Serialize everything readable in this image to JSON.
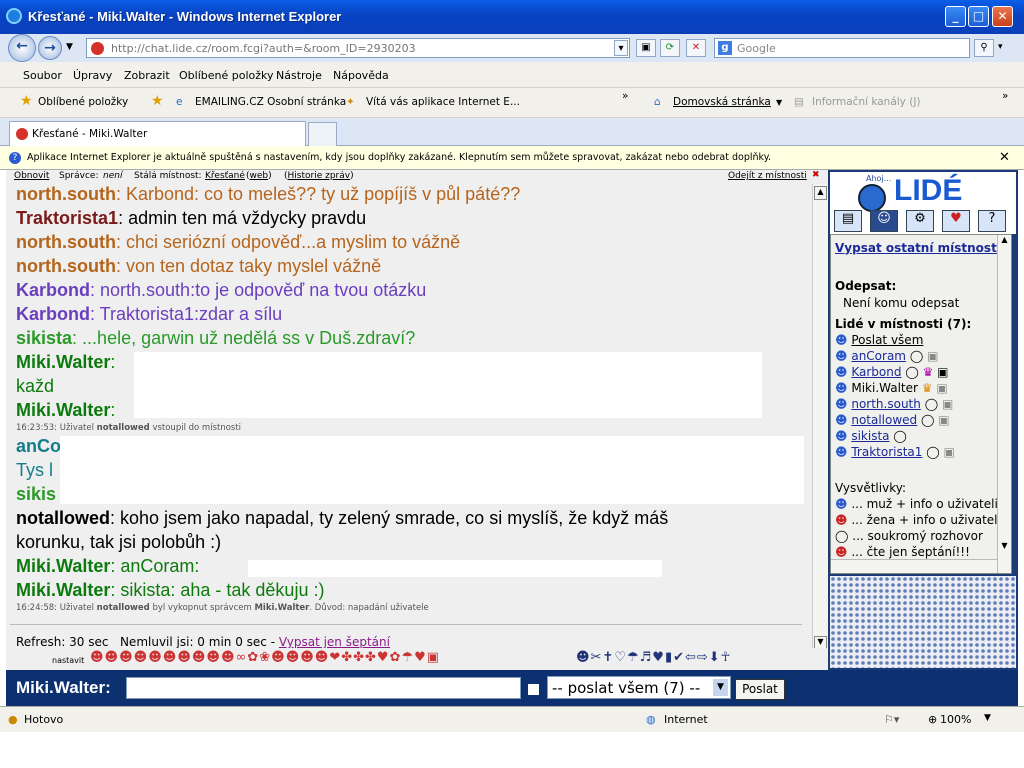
{
  "window": {
    "title": "Křesťané - Miki.Walter - Windows Internet Explorer"
  },
  "address": {
    "url": "http://chat.lide.cz/room.fcgi?auth=&room_ID=2930203",
    "search_placeholder": "Google"
  },
  "menu": [
    "Soubor",
    "Úpravy",
    "Zobrazit",
    "Oblíbené položky",
    "Nástroje",
    "Nápověda"
  ],
  "favbar": {
    "favorites": "Oblíbené položky",
    "link1": "EMAILING.CZ  Osobní stránka",
    "link2": "Vítá vás aplikace Internet E...",
    "home": "Domovská stránka",
    "feeds": "Informační kanály (J)"
  },
  "tab": {
    "label": "Křesťané - Miki.Walter"
  },
  "infobar": {
    "text": "Aplikace Internet Explorer je aktuálně spuštěná s nastavením, kdy jsou doplňky zakázané. Klepnutím sem můžete spravovat, zakázat nebo odebrat doplňky."
  },
  "chat_header": {
    "refresh_link": "Obnovit",
    "admin_label": "Správce:",
    "admin_value": "není",
    "room_label": "Stálá místnost:",
    "room_name": "Křesťané",
    "web_link": "web",
    "history_link": "Historie zpráv",
    "leave_link": "Odejít z místnosti"
  },
  "messages": [
    {
      "user": "north.south",
      "text": ": Karbond: co to meleš?? ty už popíjíš v půl páté??",
      "color": "#b5651d"
    },
    {
      "user": "Traktorista1",
      "text": ": admin ten má vždycky pravdu",
      "color": "#7a1a1a"
    },
    {
      "user": "north.south",
      "text": ": chci seriózní odpověď...a myslim to vážně",
      "color": "#b5651d"
    },
    {
      "user": "north.south",
      "text": ": von ten dotaz taky myslel vážně",
      "color": "#b5651d"
    },
    {
      "user": "Karbond",
      "text": ": north.south:to je odpověď na tvou otázku",
      "color": "#6a3fbf"
    },
    {
      "user": "Karbond",
      "text": ": Traktorista1:zdar a sílu",
      "color": "#6a3fbf"
    },
    {
      "user": "sikista",
      "text": ": ...hele, garwin už nedělá ss v Duš.zdraví?",
      "color": "#2a9a2a"
    },
    {
      "user": "Miki.Walter",
      "text": ":",
      "color": "#0d7a0d"
    },
    {
      "user": "",
      "text": "každ",
      "color": "#0d7a0d"
    },
    {
      "user": "Miki.Walter",
      "text": ":",
      "color": "#0d7a0d"
    },
    {
      "user": "anCo",
      "text": "",
      "color": "#137e8a"
    },
    {
      "user": "",
      "text": "Tys l",
      "color": "#137e8a"
    },
    {
      "user": "sikis",
      "text": "",
      "color": "#2a9a2a"
    },
    {
      "user": "notallowed",
      "text": ": koho jsem jako napadal, ty zelený smrade, co si myslíš, že když máš",
      "color": "#000000"
    },
    {
      "user": "",
      "text": "korunku, tak jsi polobůh :)",
      "color": "#000000"
    },
    {
      "user": "Miki.Walter",
      "text": ": anCoram:",
      "color": "#0d7a0d"
    },
    {
      "user": "Miki.Walter",
      "text": ": sikista: aha - tak děkuju :)",
      "color": "#0d7a0d"
    }
  ],
  "system": {
    "join": {
      "time": "16:23:53:",
      "pre": "Uživatel",
      "user": "notallowed",
      "post": "vstoupil do místnosti"
    },
    "kick": {
      "time": "16:24:58:",
      "pre": "Uživatel",
      "user": "notallowed",
      "mid": "byl vykopnut správcem",
      "admin": "Miki.Walter",
      "post": ". Důvod: napadání uživatele"
    }
  },
  "refresh": {
    "refresh": "Refresh: 30 sec",
    "idle": "Nemluvil jsi: 0 min 0 sec -",
    "whisper_link": "Vypsat jen šeptání"
  },
  "emoticons": {
    "label": "nastavit"
  },
  "input": {
    "nick_label": "Miki.Walter:",
    "send_value": "-- poslat všem (7) --",
    "send_button": "Poslat"
  },
  "right": {
    "logo_small": "Ahoj...",
    "logo": "LIDÉ",
    "list_link": "Vypsat ostatní místnosti",
    "reply_label": "Odepsat:",
    "reply_value": "Není komu odepsat",
    "people_label": "Lidé v místnosti (7):",
    "send_all": "Poslat všem",
    "people": [
      "anCoram",
      "Karbond",
      "Miki.Walter",
      "north.south",
      "notallowed",
      "sikista",
      "Traktorista1"
    ],
    "legend_label": "Vysvětlivky:",
    "legend": [
      "... muž + info o uživateli",
      "... žena + info o uživateli",
      "... soukromý rozhovor",
      "... čte jen šeptání!!!"
    ]
  },
  "status": {
    "left": "Hotovo",
    "zone": "Internet",
    "zoom": "100%"
  }
}
